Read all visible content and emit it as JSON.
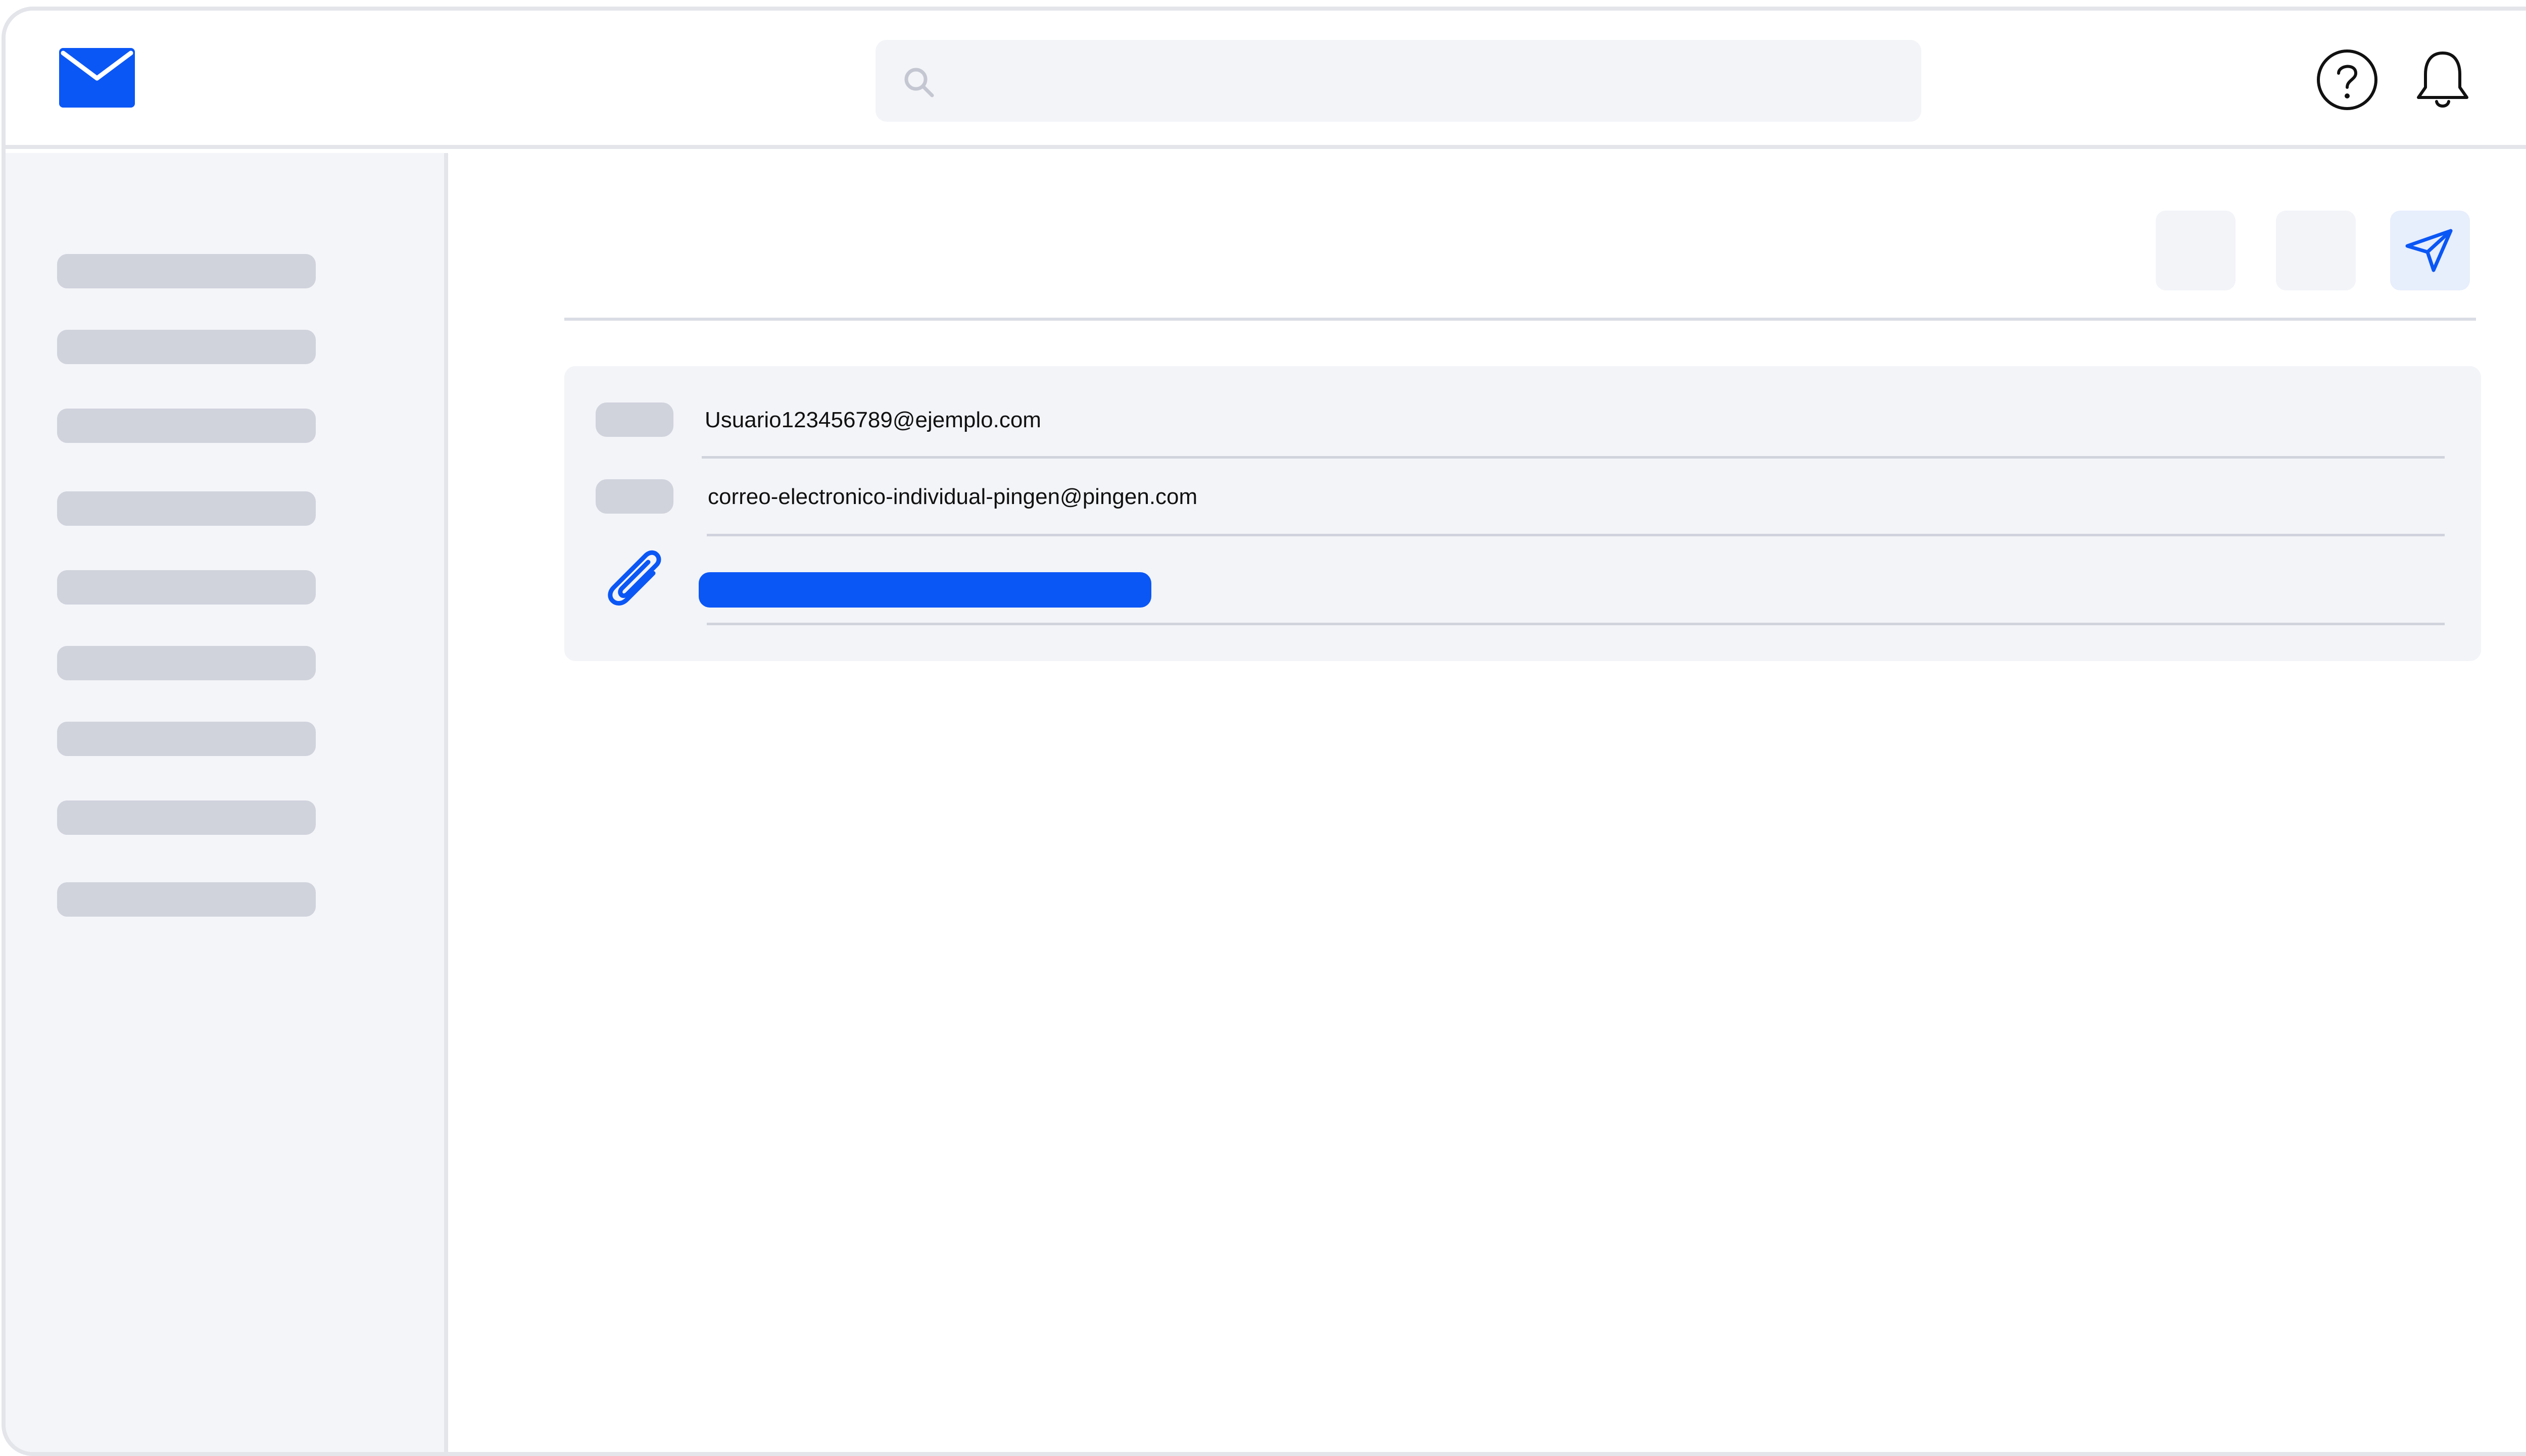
{
  "app": {
    "accent_color": "#0b57f5",
    "skeleton_color": "#d0d2dc",
    "panel_color": "#f3f4f8"
  },
  "header": {
    "logo_icon": "mail-envelope-icon",
    "search": {
      "icon": "search-icon",
      "placeholder": ""
    },
    "help_icon": "help-circle-icon",
    "bell_icon": "bell-icon"
  },
  "sidebar": {
    "items": [
      {
        "label": ""
      },
      {
        "label": ""
      },
      {
        "label": ""
      },
      {
        "label": ""
      },
      {
        "label": ""
      },
      {
        "label": ""
      },
      {
        "label": ""
      },
      {
        "label": ""
      },
      {
        "label": ""
      }
    ]
  },
  "toolbar": {
    "buttons": [
      {
        "icon": ""
      },
      {
        "icon": ""
      },
      {
        "icon": "send-icon"
      }
    ]
  },
  "message": {
    "from": "Usuario123456789@ejemplo.com",
    "to": "correo-electronico-individual-pingen@pingen.com",
    "attachment_icon": "paperclip-icon"
  }
}
